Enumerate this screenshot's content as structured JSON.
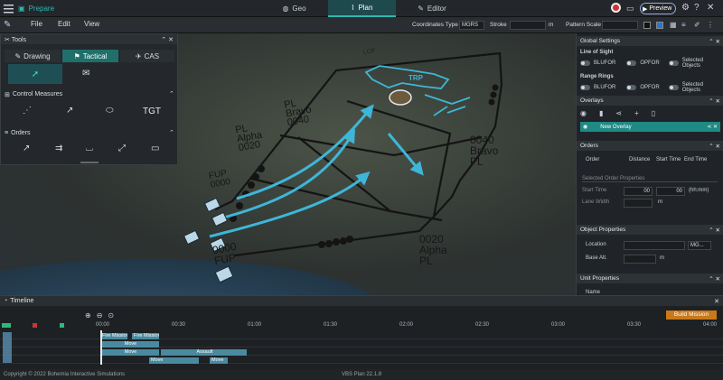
{
  "topbar": {
    "app_title": "Prepare",
    "tabs": [
      {
        "label": "Geo"
      },
      {
        "label": "Plan"
      },
      {
        "label": "Editor"
      }
    ],
    "preview_label": "Preview"
  },
  "menubar": {
    "items": [
      "File",
      "Edit",
      "View"
    ],
    "coord_type_label": "Coordinates Type",
    "coord_type_value": "MGRS",
    "stroke_label": "Stroke",
    "stroke_unit": "m",
    "pattern_scale_label": "Pattern Scale"
  },
  "tools": {
    "title": "Tools",
    "tabs": [
      "Drawing",
      "Tactical",
      "CAS"
    ],
    "control_measures_label": "Control Measures",
    "tgt_label": "TGT",
    "orders_label": "Orders"
  },
  "map_labels": {
    "lof": "LOF",
    "trp": "TRP",
    "pl_bravo_left": "PL\nBravo\n0040",
    "pl_alpha_left": "PL\nAlpha\n0020",
    "bravo_right": "0040\nBravo\nPL",
    "alpha_right": "0020\nAlpha\nPL",
    "fup_top": "FUP\n0000",
    "fup_bottom": "0000\nFUP"
  },
  "global_settings": {
    "title": "Global Settings",
    "line_of_sight": "Line of Sight",
    "range_rings": "Range Rings",
    "opt_blufor": "BLUFOR",
    "opt_opfor": "OPFOR",
    "opt_selected": "Selected Objects"
  },
  "overlays": {
    "title": "Overlays",
    "item": "New Overlay"
  },
  "orders": {
    "title": "Orders",
    "cols": [
      "Order",
      "Distance",
      "Start Time",
      "End Time"
    ],
    "selected_props": "Selected Order Properties",
    "start_time_label": "Start Time",
    "start_h": "00",
    "start_m": "00",
    "time_unit": "(hh:mm)",
    "lane_width_label": "Lane Width",
    "lane_unit": "m"
  },
  "object_properties": {
    "title": "Object Properties",
    "location_label": "Location",
    "location_value": "MG...",
    "base_alt_label": "Base Alt.",
    "base_alt_unit": "m"
  },
  "unit_properties": {
    "title": "Unit Properties",
    "name_label": "Name"
  },
  "timeline": {
    "title": "Timeline",
    "build_label": "Build Mission",
    "ticks": [
      "00:00",
      "00:30",
      "01:00",
      "01:30",
      "02:00",
      "02:30",
      "03:00",
      "03:30",
      "04:00"
    ],
    "bars_row1": [
      "Fire Mission",
      "Fire Mission"
    ],
    "bars_row2": [
      "Move"
    ],
    "bars_row3": [
      "Move",
      "Assault"
    ],
    "bars_row4": [
      "Move",
      "Move"
    ]
  },
  "status": {
    "copyright": "Copyright © 2022 Bohemia Interactive Simulations",
    "version": "VBS Plan 22.1.8"
  },
  "colors": {
    "accent": "#2fb8b0",
    "arrow": "#3fb6d8",
    "line": "#141414"
  }
}
